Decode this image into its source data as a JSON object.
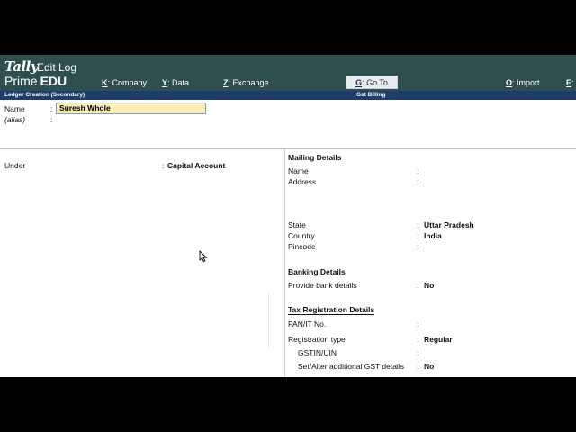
{
  "header": {
    "logo_tally": "Tally",
    "logo_prime": "Prime",
    "logo_edu": "EDU",
    "title": "Edit Log"
  },
  "menu": {
    "company": {
      "key": "K",
      "label": ": Company"
    },
    "data": {
      "key": "Y",
      "label": ": Data"
    },
    "exchange": {
      "key": "Z",
      "label": ": Exchange"
    },
    "goto": {
      "key": "G",
      "label": ": Go To"
    },
    "import": {
      "key": "O",
      "label": ": Import"
    },
    "export_key": "E",
    "export_label": ":"
  },
  "subbar": {
    "left": "Ledger Creation (Secondary)",
    "center": "Gst Billing"
  },
  "ledger": {
    "name_label": "Name",
    "name_value": "Suresh Whole",
    "alias_label": "(alias)",
    "under_label": "Under",
    "under_value": "Capital Account"
  },
  "mailing": {
    "title": "Mailing Details",
    "name_label": "Name",
    "address_label": "Address",
    "state_label": "State",
    "state_value": "Uttar Pradesh",
    "country_label": "Country",
    "country_value": "India",
    "pincode_label": "Pincode"
  },
  "banking": {
    "title": "Banking Details",
    "provide_label": "Provide bank details",
    "provide_value": "No"
  },
  "tax": {
    "title": "Tax Registration Details",
    "pan_label": "PAN/IT No.",
    "reg_type_label": "Registration type",
    "reg_type_value": "Regular",
    "gstin_label": "GSTIN/UIN",
    "gst_details_label": "Set/Alter additional GST details",
    "gst_details_value": "No"
  },
  "colon": ":"
}
